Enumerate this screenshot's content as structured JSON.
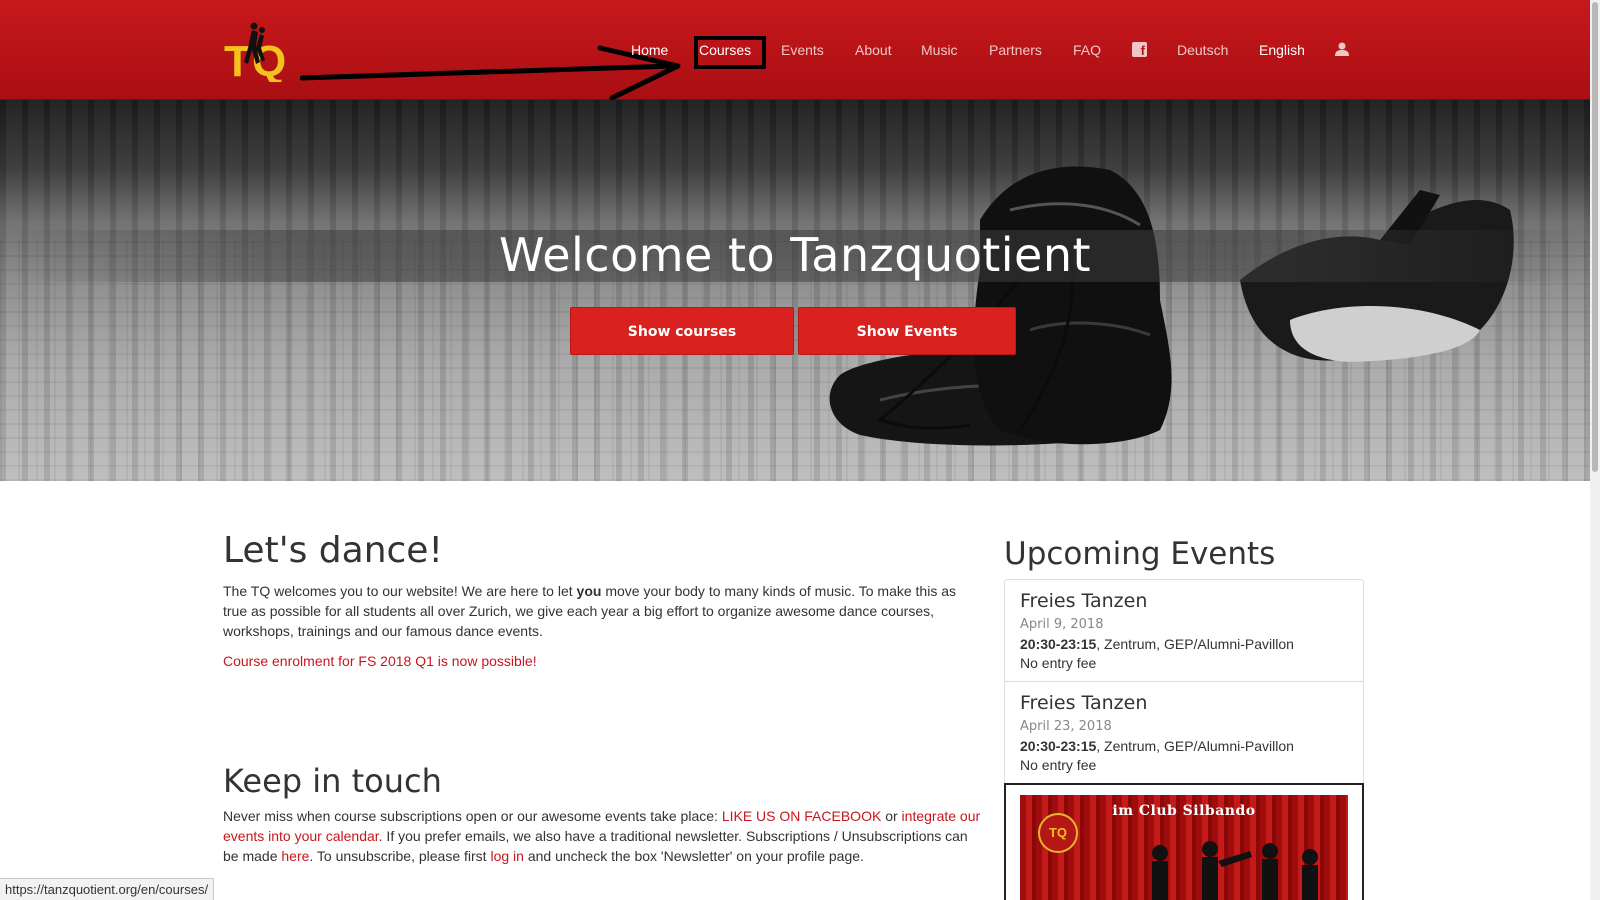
{
  "nav": {
    "logo_alt": "TQ",
    "items": [
      {
        "label": "Home"
      },
      {
        "label": "Courses"
      },
      {
        "label": "Events"
      },
      {
        "label": "About"
      },
      {
        "label": "Music"
      },
      {
        "label": "Partners"
      },
      {
        "label": "FAQ"
      }
    ],
    "facebook_icon": "facebook-icon",
    "languages": [
      {
        "label": "Deutsch"
      },
      {
        "label": "English"
      }
    ],
    "user_icon": "user-icon",
    "highlight_color": "#000000"
  },
  "hero": {
    "title": "Welcome to Tanzquotient",
    "show_courses": "Show courses",
    "show_events": "Show Events"
  },
  "main": {
    "heading": "Let's dance!",
    "intro_before": "The TQ welcomes you to our website! We are here to let ",
    "intro_bold": "you",
    "intro_after": " move your body to many kinds of music. To make this as true as possible for all students all over Zurich, we give each year a big effort to organize awesome dance courses, workshops, trainings and our famous dance events.",
    "enrolment": "Course enrolment for FS 2018 Q1 is now possible!",
    "keep_heading": "Keep in touch",
    "keep_1": "Never miss when course subscriptions open or our awesome events take place: ",
    "keep_link_fb": "LIKE US ON FACEBOOK",
    "keep_2": " or ",
    "keep_link_cal": "integrate our events into your calendar",
    "keep_3": ". If you prefer emails, we also have a traditional newsletter. Subscriptions / Unsubscriptions can be made ",
    "keep_link_here": "here",
    "keep_4": ". To unsubscribe, please first ",
    "keep_link_login": "log in",
    "keep_5": " and uncheck the box 'Newsletter' on your profile page."
  },
  "sidebar": {
    "heading": "Upcoming Events",
    "events": [
      {
        "title": "Freies Tanzen",
        "date": "April 9, 2018",
        "time": "20:30-23:15",
        "place": ", Zentrum, GEP/Alumni-Pavillon",
        "fee": "No entry fee"
      },
      {
        "title": "Freies Tanzen",
        "date": "April 23, 2018",
        "time": "20:30-23:15",
        "place": ", Zentrum, GEP/Alumni-Pavillon",
        "fee": "No entry fee"
      }
    ],
    "poster_title": "im Club Silbando",
    "poster_logo": "TQ"
  },
  "status": {
    "url": "https://tanzquotient.org/en/courses/"
  },
  "colors": {
    "brand_red": "#c8181c",
    "accent_link": "#c8161d",
    "logo_yellow": "#f3c21d"
  }
}
